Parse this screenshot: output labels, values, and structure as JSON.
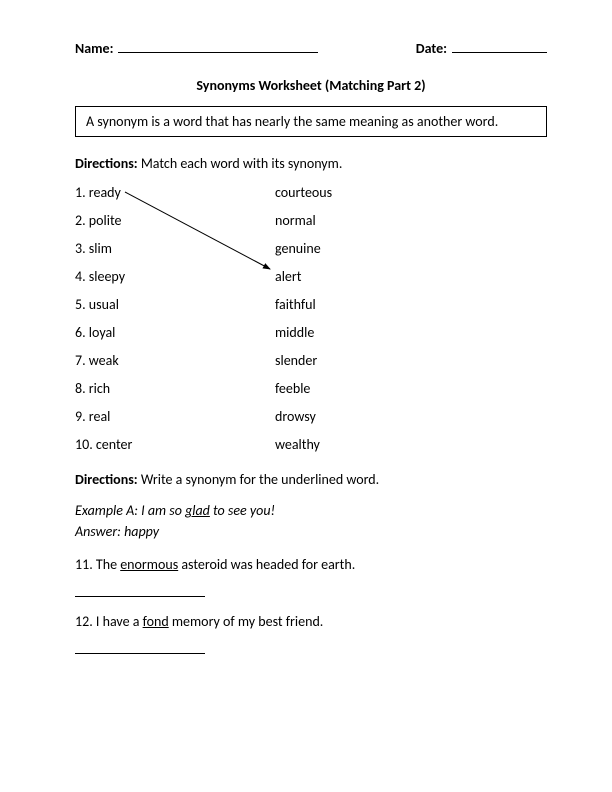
{
  "header": {
    "name_label": "Name:",
    "date_label": "Date:"
  },
  "title": "Synonyms Worksheet (Matching Part 2)",
  "definition": "A synonym is a word that has nearly the same meaning as another word.",
  "part1": {
    "directions_label": "Directions:",
    "directions_text": " Match each word with its synonym.",
    "rows": [
      {
        "left": "1. ready",
        "right": "courteous"
      },
      {
        "left": "2. polite",
        "right": "normal"
      },
      {
        "left": "3. slim",
        "right": "genuine"
      },
      {
        "left": "4. sleepy",
        "right": "alert"
      },
      {
        "left": "5. usual",
        "right": "faithful"
      },
      {
        "left": "6. loyal",
        "right": "middle"
      },
      {
        "left": "7. weak",
        "right": "slender"
      },
      {
        "left": "8. rich",
        "right": "feeble"
      },
      {
        "left": "9. real",
        "right": "drowsy"
      },
      {
        "left": "10. center",
        "right": "wealthy"
      }
    ]
  },
  "part2": {
    "directions_label": "Directions:",
    "directions_text": " Write a synonym for the underlined word.",
    "example_label": "Example A: I am so ",
    "example_underlined": "glad",
    "example_suffix": " to see you!",
    "answer_label": "Answer: happy",
    "q11_prefix": "11. The ",
    "q11_underlined": "enormous",
    "q11_suffix": " asteroid was headed for earth.",
    "q12_prefix": "12. I have a ",
    "q12_underlined": "fond",
    "q12_suffix": " memory of my best friend."
  }
}
